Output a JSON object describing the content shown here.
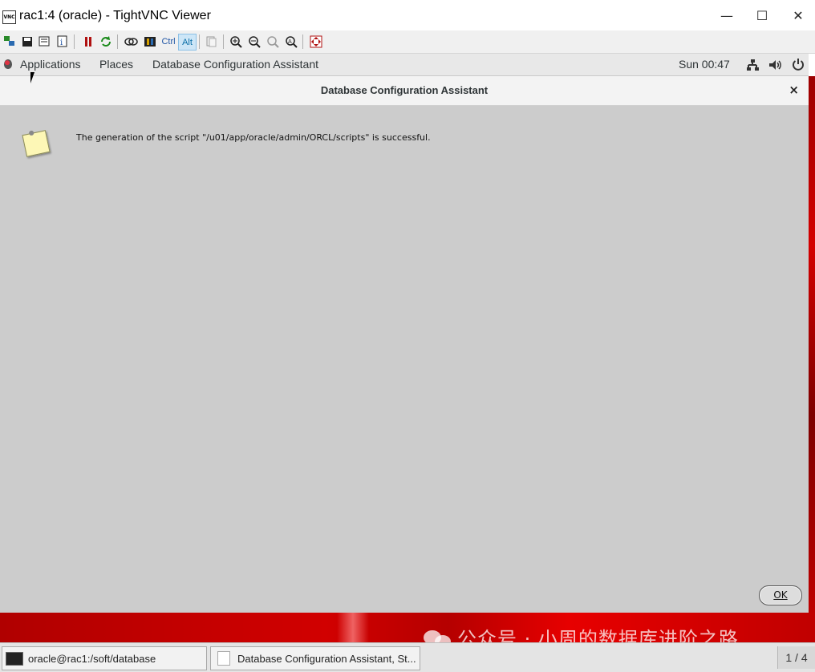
{
  "window": {
    "title": "rac1:4 (oracle) - TightVNC Viewer",
    "icon_text": "VNC",
    "minimize": "—",
    "maximize": "☐",
    "close": "✕"
  },
  "toolbar": {
    "ctrl_label": "Ctrl",
    "alt_label": "Alt"
  },
  "gnome_panel": {
    "applications": "Applications",
    "places": "Places",
    "active_app": "Database Configuration Assistant",
    "clock": "Sun 00:47"
  },
  "dialog": {
    "title": "Database Configuration Assistant",
    "close": "×",
    "message": "The generation of the script \"/u01/app/oracle/admin/ORCL/scripts\" is successful.",
    "ok_label": "OK"
  },
  "desktop": {
    "watermark": "公众号 · 小周的数据库进阶之路"
  },
  "taskbar": {
    "terminal_task": "oracle@rac1:/soft/database",
    "dca_task": "Database Configuration Assistant, St...",
    "workspace": "1 / 4"
  },
  "colors": {
    "dialog_bg": "#cccccc",
    "desktop_red": "#d10000",
    "panel_bg": "#e8e8e8"
  }
}
